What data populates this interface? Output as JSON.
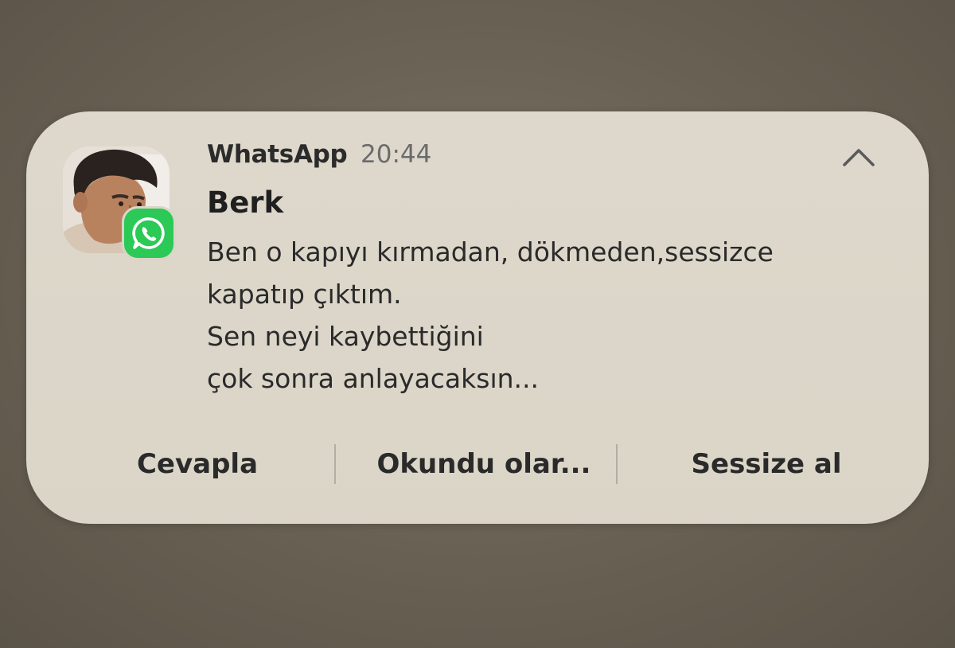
{
  "notification": {
    "app_name": "WhatsApp",
    "time": "20:44",
    "sender": "Berk",
    "message_lines": [
      "Ben o kapıyı kırmadan, dökmeden,sessizce",
      "kapatıp çıktım.",
      "Sen neyi kaybettiğini",
      "çok sonra anlayacaksın..."
    ],
    "collapse_icon": "chevron-up-icon",
    "badge_icon": "whatsapp-icon"
  },
  "actions": {
    "reply": "Cevapla",
    "mark_read": "Okundu olar...",
    "mute": "Sessize al"
  },
  "colors": {
    "card_background": "#dbd5c8",
    "whatsapp_green": "#2bc955"
  }
}
